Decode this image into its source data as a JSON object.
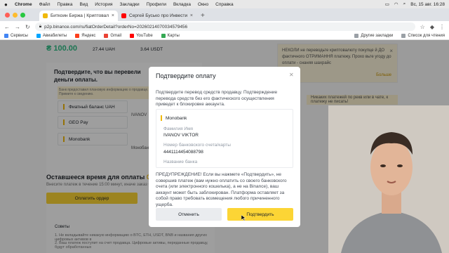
{
  "menubar": {
    "app": "Chrome",
    "items": [
      "Файл",
      "Правка",
      "Вид",
      "История",
      "Закладки",
      "Профили",
      "Вкладка",
      "Окно",
      "Справка"
    ],
    "datetime": "Вс, 15 авг.  16:28"
  },
  "tabs": [
    {
      "title": "Биткоин Биржа | Криптовалю…",
      "active": true
    },
    {
      "title": "Сергей Бусько про Инвестиц…",
      "active": false
    }
  ],
  "address": {
    "url": "p2p.binance.com/ru/fiatOrderDetail?orderNo=20260214070034579456"
  },
  "bookmarks": {
    "items": [
      "Сервисы",
      "Авиабилеты",
      "Яндекс",
      "Gmail",
      "YouTube",
      "Карты"
    ],
    "others": "Другие закладки",
    "reading_list": "Список для чтения"
  },
  "order": {
    "amount": "₴ 100.00",
    "price": "27.44 UAH",
    "quantity": "3.64 USDT"
  },
  "notice": {
    "text": "НЕКОЛИ не переводьте криптовалюту покупце й ДО фактичного ОТРИМАННЯ платежу. Прохо вьте угоду до оплати - снаняя шахрайс",
    "more": "Больше"
  },
  "page": {
    "confirm_heading": "Подтвердите, что вы перевели деньги оплаты.",
    "warn_note": "Банк предоставил плановую информацию о продавце. Примите к сведению.",
    "methods": [
      "Фиатный баланс UAH",
      "GEO Pay",
      "Monobank"
    ],
    "seller_name": "IVANOV",
    "seller_bank": "Монобан",
    "timer_label": "Оставшееся время для оплаты",
    "timer_value": "00",
    "timer_sub": "Внесите платеж в течение 15:00 минут, иначе заказ бу",
    "paid_button": "Оплатить ордер",
    "tips_title": "Советы",
    "tips_line1": "1. Не вкладывайте никакую информацию о BTC, ETH, USDT, BNB и названия других цифровых активов в",
    "tips_line2": "2. Ваш платеж поступит на счет продавца. Цифровые активы, переданные продавцу, будут обработанных"
  },
  "chat_note": "Никаких платежей по рекв или в чате, к платежу не писать!",
  "modal": {
    "title": "Подтвердите оплату",
    "description": "Подтвердите перевод средств продавцу. Подтверждение перевода средств без его фактического осуществления приведет к блокировке аккаунта.",
    "bank": "Monobank",
    "name_label": "Фамилия Имя",
    "name_value": "IVANOV VIKTOR",
    "account_label": "Номер банковского счета/карты",
    "account_value": "4441114454088798",
    "bank_name_label": "Название банка",
    "warning": "ПРЕДУПРЕЖДЕНИЕ! Если вы нажмете «Подтвердить», не совершив платеж (вам нужно оплатить со своего банковского счета (или электронного кошелька), а не на Binance), ваш аккаунт может быть заблокирован. Платформа оставляет за собой право требовать возмещения любого причиненного ущерба.",
    "cancel": "Отменить",
    "confirm": "Подтвердить"
  },
  "colors": {
    "accent": "#fcd535",
    "buy_green": "#2ebd85",
    "overlay": "rgba(0,0,0,0.38)"
  }
}
